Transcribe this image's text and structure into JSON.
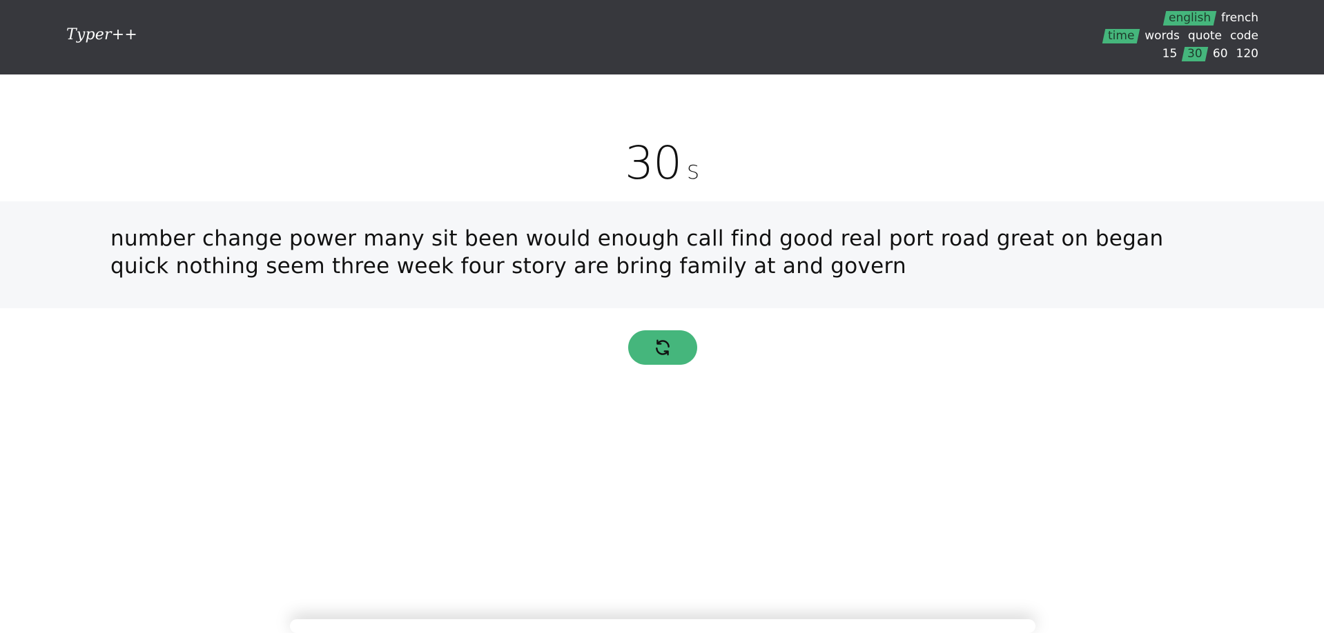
{
  "app": {
    "logo": "Typer++"
  },
  "options": {
    "languages": [
      {
        "label": "english",
        "active": true
      },
      {
        "label": "french",
        "active": false
      }
    ],
    "modes": [
      {
        "label": "time",
        "active": true
      },
      {
        "label": "words",
        "active": false
      },
      {
        "label": "quote",
        "active": false
      },
      {
        "label": "code",
        "active": false
      }
    ],
    "durations": [
      {
        "label": "15",
        "active": false
      },
      {
        "label": "30",
        "active": true
      },
      {
        "label": "60",
        "active": false
      },
      {
        "label": "120",
        "active": false
      }
    ]
  },
  "timer": {
    "value": "30",
    "unit": "S"
  },
  "words": {
    "text": "number change power many sit been would enough call find good real port road great on began quick nothing seem three week four story are bring family at and govern"
  },
  "restart": {
    "icon": "refresh-icon"
  },
  "colors": {
    "header_bg": "#37383d",
    "accent": "#45b67c",
    "words_bg": "#f6f7f9"
  }
}
